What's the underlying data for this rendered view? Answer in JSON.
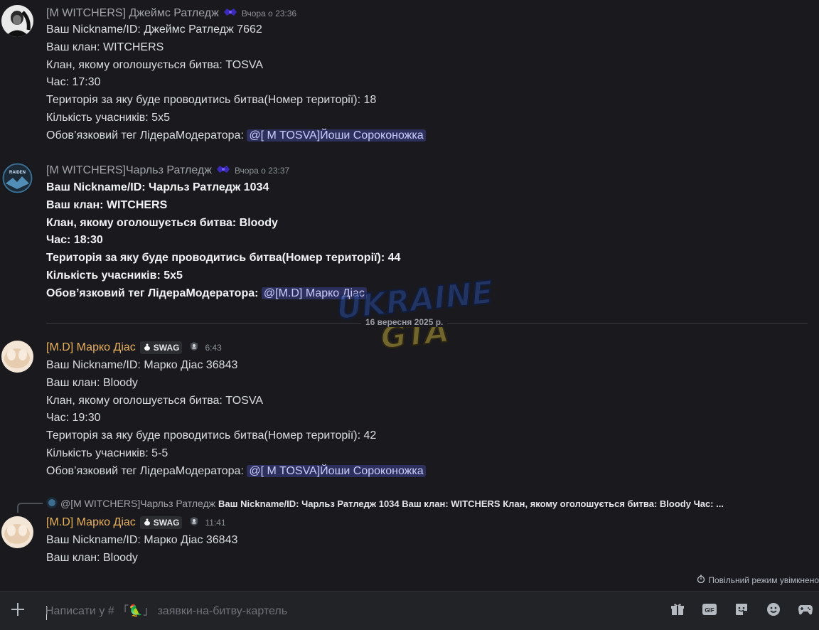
{
  "messages": [
    {
      "author": "[M WITCHERS] Джеймс Ратледж",
      "timestamp": "Вчора о 23:36",
      "lines": [
        "Ваш Nickname/ID: Джеймс Ратледж 7662",
        "Ваш клан: WITCHERS",
        "Клан, якому оголошується битва: TOSVA",
        "Час: 17:30",
        "Територія за яку буде проводитись битва(Номер території): 18",
        "Кількість учасників:  5x5"
      ],
      "tag_line_prefix": "Обов’язковий тег ЛідераМодератора: ",
      "mention": "@[ M TOSVA]Йоши Сороконожка"
    },
    {
      "author": "[M WITCHERS]Чарльз Ратледж",
      "timestamp": "Вчора о 23:37",
      "avatar_text": "RAIDEN",
      "lines": [
        "Ваш Nickname/ID: Чарльз Ратледж 1034",
        "Ваш клан: WITCHERS",
        "Клан, якому оголошується битва: Bloody",
        "Час: 18:30",
        "Територія за яку буде проводитись битва(Номер території): 44",
        "Кількість учасників:  5x5"
      ],
      "tag_line_prefix": "Обов’язковий тег ЛідераМодератора: ",
      "mention": "@[M.D] Марко Діас"
    },
    {
      "author": "[M.D] Марко Діас",
      "tag": "SWAG",
      "timestamp": "6:43",
      "lines": [
        "Ваш Nickname/ID: Марко Діас 36843",
        "Ваш клан: Bloody",
        "Клан, якому оголошується битва: TOSVA",
        "Час: 19:30",
        "Територія за яку буде проводитись битва(Номер території): 42",
        "Кількість учасників: 5-5"
      ],
      "tag_line_prefix": "Обов’язковий тег ЛідераМодератора: ",
      "mention": "@[ M TOSVA]Йоши Сороконожка"
    },
    {
      "author": "[M.D] Марко Діас",
      "tag": "SWAG",
      "timestamp": "11:41",
      "reply_to_name": "@[M WITCHERS]Чарльз Ратледж",
      "reply_to_text": "Ваш Nickname/ID: Чарльз Ратледж 1034 Ваш клан: WITCHERS Клан, якому оголошується битва: Bloody Час: ...",
      "lines": [
        "Ваш Nickname/ID: Марко Діас 36843",
        "Ваш клан: Bloody"
      ]
    }
  ],
  "date_divider": "16 вересня 2025 р.",
  "watermark_lines": [
    "UKRAINE",
    "GTA"
  ],
  "slowmode_text": "Повільний режим увімкнено",
  "composer": {
    "placeholder": "Написати у # 「🦜」 заявки-на-битву-картель"
  },
  "colors": {
    "background": "#1a1a1e",
    "mention_bg": "#3c4270",
    "gold_name": "#e8b15a",
    "gray_name": "#a0a3a8"
  },
  "icons": [
    "plus-icon",
    "gift-icon",
    "gif-icon",
    "sticker-icon",
    "emoji-icon",
    "activity-icon",
    "timer-icon",
    "role-badge-icon",
    "clan-tag-icon"
  ]
}
